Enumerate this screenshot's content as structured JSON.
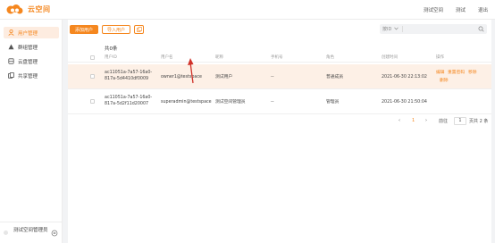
{
  "app": {
    "name": "云空间"
  },
  "topbar": {
    "links": [
      "测试空间",
      "测试",
      "退出"
    ]
  },
  "sidebar": {
    "items": [
      {
        "label": "用户管理",
        "icon": "user-icon",
        "active": true
      },
      {
        "label": "群组管理",
        "icon": "group-icon",
        "active": false
      },
      {
        "label": "云盘管理",
        "icon": "disk-icon",
        "active": false
      },
      {
        "label": "共享管理",
        "icon": "share-icon",
        "active": false
      }
    ],
    "footer_user": "测试空间管理员"
  },
  "toolbar": {
    "add_label": "添加用户",
    "import_label": "导入用户",
    "more_icon": "copy-icon"
  },
  "search": {
    "dropdown_label": "按ID",
    "placeholder": ""
  },
  "table": {
    "title": "共0条",
    "columns": [
      "用户ID",
      "用户名",
      "昵称",
      "手机号",
      "角色",
      "创建时间",
      "操作"
    ],
    "rows": [
      {
        "id": "ac11051a-7a57-16a0-817a-5d4410df0009",
        "username": "owner1@testspace",
        "nickname": "测试用户",
        "phone": "--",
        "role": "普通成员",
        "created": "2021-06-30 22:13:02",
        "actions": [
          "编辑",
          "重置密码",
          "移除",
          "删除"
        ],
        "highlighted": true
      },
      {
        "id": "ac11051a-7a57-16a0-817a-5d2f11d20007",
        "username": "superadmin@testspace",
        "nickname": "测试空间管理员",
        "phone": "--",
        "role": "管理员",
        "created": "2021-06-30 21:50:04",
        "actions": [],
        "highlighted": false
      }
    ]
  },
  "pager": {
    "prev": "‹",
    "current": "1",
    "next": "›",
    "goto_label": "前往",
    "goto_value": "1",
    "total": "页共 2 条"
  },
  "colors": {
    "accent": "#f5871f",
    "highlight": "#fdf0e6",
    "annotation": "#d0322a"
  }
}
